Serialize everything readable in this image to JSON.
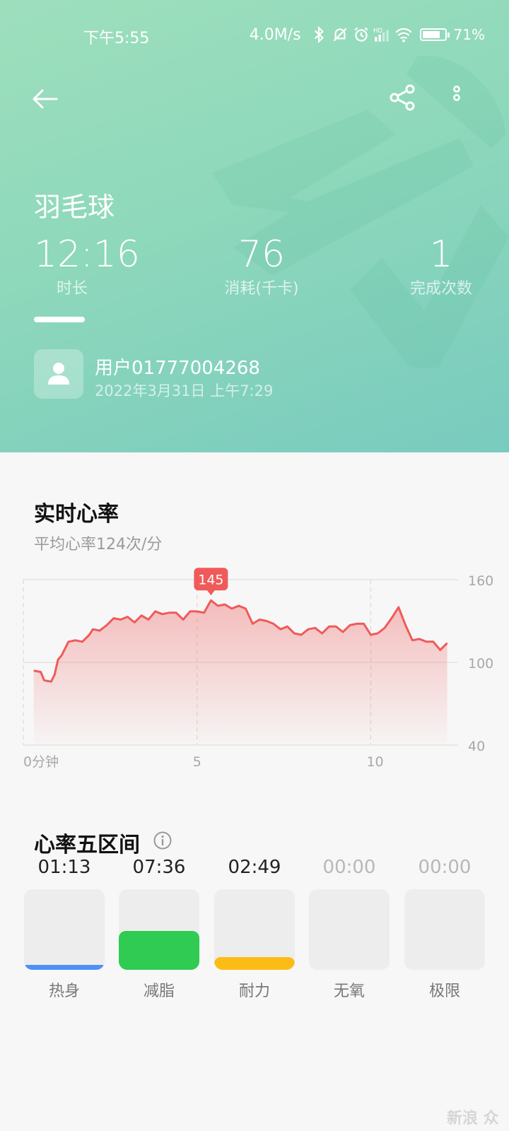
{
  "status_bar": {
    "time": "下午5:55",
    "network_speed": "4.0M/s",
    "battery_percent": "71%",
    "battery_level": 0.71,
    "icons": [
      "bluetooth-icon",
      "mute-icon",
      "alarm-icon",
      "hd-signal-icon",
      "wifi-icon",
      "battery-icon"
    ]
  },
  "header": {
    "back_icon": "arrow-left-icon",
    "share_icon": "share-icon",
    "more_icon": "more-vertical-icon",
    "sport_name": "羽毛球",
    "stats": [
      {
        "value": "12:16",
        "label": "时长"
      },
      {
        "value": "76",
        "label": "消耗(千卡)"
      },
      {
        "value": "1",
        "label": "完成次数"
      }
    ],
    "user": {
      "name": "用户01777004268",
      "datetime": "2022年3月31日 上午7:29",
      "avatar_icon": "user-avatar-icon"
    },
    "colors": {
      "gradient_start": "#9ddfbd",
      "gradient_end": "#79cbbf"
    }
  },
  "heart_rate": {
    "title": "实时心率",
    "subtitle": "平均心率124次/分"
  },
  "chart_data": {
    "type": "area",
    "title": "",
    "xlabel": "",
    "ylabel": "",
    "x_ticks": [
      "0分钟",
      "5",
      "10"
    ],
    "x_tick_values": [
      0,
      5,
      10
    ],
    "y_ticks": [
      160,
      100,
      40
    ],
    "xlim": [
      0,
      12.27
    ],
    "ylim": [
      40,
      160
    ],
    "grid": true,
    "peak": {
      "x": 5.4,
      "y": 145,
      "label": "145"
    },
    "color": "#f05a5a",
    "x": [
      0.3,
      0.5,
      0.6,
      0.8,
      0.9,
      1.0,
      1.1,
      1.3,
      1.5,
      1.7,
      1.9,
      2.0,
      2.2,
      2.4,
      2.6,
      2.8,
      3.0,
      3.2,
      3.4,
      3.6,
      3.8,
      4.0,
      4.2,
      4.4,
      4.6,
      4.8,
      5.0,
      5.2,
      5.4,
      5.6,
      5.8,
      6.0,
      6.2,
      6.4,
      6.6,
      6.8,
      7.0,
      7.2,
      7.4,
      7.6,
      7.8,
      8.0,
      8.2,
      8.4,
      8.6,
      8.8,
      9.0,
      9.2,
      9.4,
      9.6,
      9.8,
      10.0,
      10.2,
      10.4,
      10.6,
      10.8,
      11.0,
      11.2,
      11.4,
      11.6,
      11.8,
      12.0,
      12.2
    ],
    "y": [
      94,
      93,
      87,
      86,
      91,
      102,
      105,
      115,
      116,
      115,
      120,
      124,
      123,
      127,
      132,
      131,
      133,
      129,
      134,
      131,
      137,
      135,
      136,
      136,
      131,
      137,
      137,
      136,
      145,
      141,
      142,
      139,
      141,
      139,
      128,
      131,
      130,
      128,
      124,
      126,
      121,
      120,
      124,
      125,
      121,
      126,
      126,
      122,
      127,
      128,
      128,
      120,
      121,
      125,
      132,
      140,
      127,
      116,
      117,
      115,
      115,
      109,
      114
    ]
  },
  "zones": {
    "title": "心率五区间",
    "info_icon": "info-icon",
    "items": [
      {
        "label": "热身",
        "time": "01:13",
        "fill": 0.06,
        "color": "#4f8ff7",
        "active": true
      },
      {
        "label": "减脂",
        "time": "07:36",
        "fill": 0.48,
        "color": "#2fcb52",
        "active": true
      },
      {
        "label": "耐力",
        "time": "02:49",
        "fill": 0.16,
        "color": "#fbbc16",
        "active": true
      },
      {
        "label": "无氧",
        "time": "00:00",
        "fill": 0,
        "color": "#e0e0e0",
        "active": false
      },
      {
        "label": "极限",
        "time": "00:00",
        "fill": 0,
        "color": "#e0e0e0",
        "active": false
      }
    ]
  },
  "watermark": "新浪 众测"
}
